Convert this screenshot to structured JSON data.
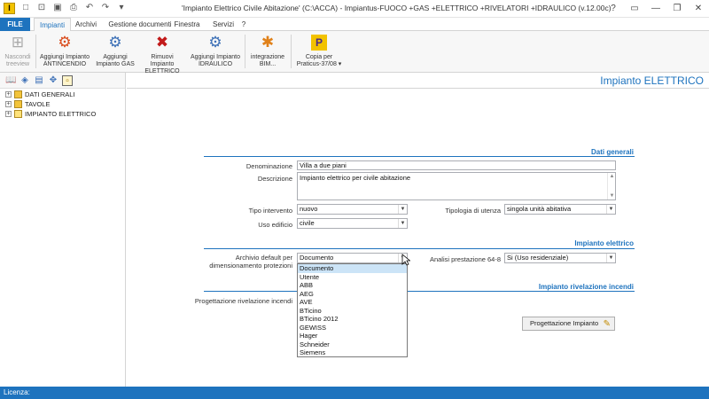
{
  "titlebar": {
    "app_icon": "I",
    "title": "'Impianto Elettrico Civile Abitazione' (C:\\ACCA) - Impiantus-FUOCO +GAS +ELETTRICO +RIVELATORI +IDRAULICO (v.12.00c)",
    "qat_icons": [
      "new-icon",
      "open-icon",
      "save-icon",
      "print-icon",
      "undo-icon",
      "redo-icon",
      "dropdown-icon"
    ],
    "window_controls": [
      "?",
      "▭",
      "—",
      "❐",
      "✕"
    ]
  },
  "menu": {
    "file": "FILE",
    "tabs": [
      "Impianti",
      "Archivi",
      "Gestione documenti",
      "Finestra",
      "Servizi",
      "?"
    ]
  },
  "ribbon": {
    "nascondi": [
      "Nascondi",
      "treeview"
    ],
    "aggiungi_antincendio": [
      "Aggiungi Impianto",
      "ANTINCENDIO"
    ],
    "aggiungi_gas": [
      "Aggiungi",
      "Impianto GAS"
    ],
    "rimuovi_elettrico": [
      "Rimuovi Impianto",
      "ELETTRICO"
    ],
    "aggiungi_idraulico": [
      "Aggiungi Impianto",
      "IDRAULICO"
    ],
    "integrazione_bim": [
      "integrazione",
      "BIM..."
    ],
    "copia_praticus": [
      "Copia per",
      "Praticus-37/08 ▾"
    ]
  },
  "tree": {
    "items": [
      "DATI GENERALI",
      "TAVOLE",
      "IMPIANTO ELETTRICO"
    ]
  },
  "main": {
    "title": "Impianto ELETTRICO",
    "dati_generali": {
      "heading": "Dati generali",
      "denominazione_label": "Denominazione",
      "denominazione_value": "Villa a due piani",
      "descrizione_label": "Descrizione",
      "descrizione_value": "Impianto elettrico per civile abitazione",
      "tipo_intervento_label": "Tipo intervento",
      "tipo_intervento_value": "nuovo",
      "tipologia_utenza_label": "Tipologia di utenza",
      "tipologia_utenza_value": "singola unità abitativa",
      "uso_edificio_label": "Uso edificio",
      "uso_edificio_value": "civile"
    },
    "impianto_elettrico": {
      "heading": "Impianto elettrico",
      "archivio_label_1": "Archivio default per",
      "archivio_label_2": "dimensionamento protezioni",
      "archivio_value": "Documento",
      "analisi_label": "Analisi prestazione 64-8",
      "analisi_value": "Si (Uso residenziale)",
      "archivio_options": [
        "Documento",
        "Utente",
        "ABB",
        "AEG",
        "AVE",
        "BTicino",
        "BTicino 2012",
        "GEWISS",
        "Hager",
        "Schneider",
        "Siemens"
      ]
    },
    "rivelazione_incendi": {
      "heading": "Impianto rivelazione incendi",
      "progettazione_label": "Progettazione rivelazione incendi",
      "progettazione_button": "Progettazione Impianto"
    }
  },
  "status": {
    "licenza": "Licenza:"
  },
  "colors": {
    "accent": "#1e73be"
  }
}
